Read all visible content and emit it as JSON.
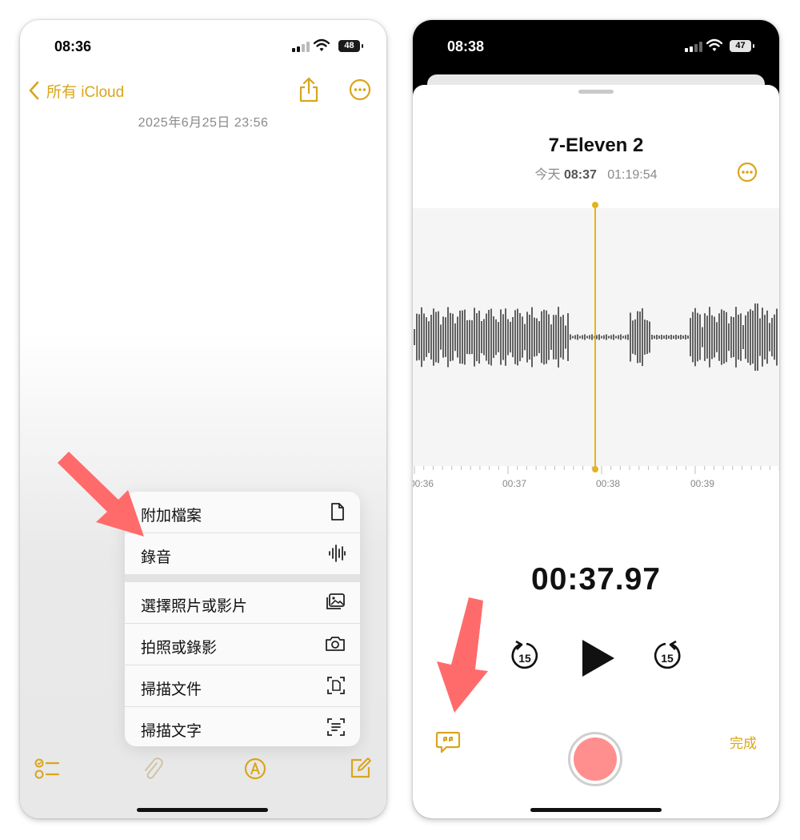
{
  "left_phone": {
    "status": {
      "time": "08:36",
      "battery": "48"
    },
    "nav": {
      "back_label": "所有 iCloud"
    },
    "note": {
      "date": "2025年6月25日 23:56"
    },
    "menu": {
      "items": [
        {
          "label": "附加檔案",
          "icon": "document-icon"
        },
        {
          "label": "錄音",
          "icon": "waveform-icon"
        },
        {
          "label": "選擇照片或影片",
          "icon": "photo-library-icon"
        },
        {
          "label": "拍照或錄影",
          "icon": "camera-icon"
        },
        {
          "label": "掃描文件",
          "icon": "scan-document-icon"
        },
        {
          "label": "掃描文字",
          "icon": "scan-text-icon"
        }
      ]
    },
    "accent_color": "#d9a51a"
  },
  "right_phone": {
    "status": {
      "time": "08:38",
      "battery": "47"
    },
    "recording": {
      "title": "7-Eleven 2",
      "day": "今天",
      "time": "08:37",
      "duration": "01:19:54"
    },
    "timeline": {
      "ticks": [
        "00:36",
        "00:37",
        "00:38",
        "00:39"
      ]
    },
    "player": {
      "elapsed": "00:37.97",
      "skip_back": "15",
      "skip_forward": "15"
    },
    "done_label": "完成",
    "accent_color": "#d9a51a",
    "record_button_color": "#ff8f8f"
  },
  "annotation_color": "#ff6b6b"
}
